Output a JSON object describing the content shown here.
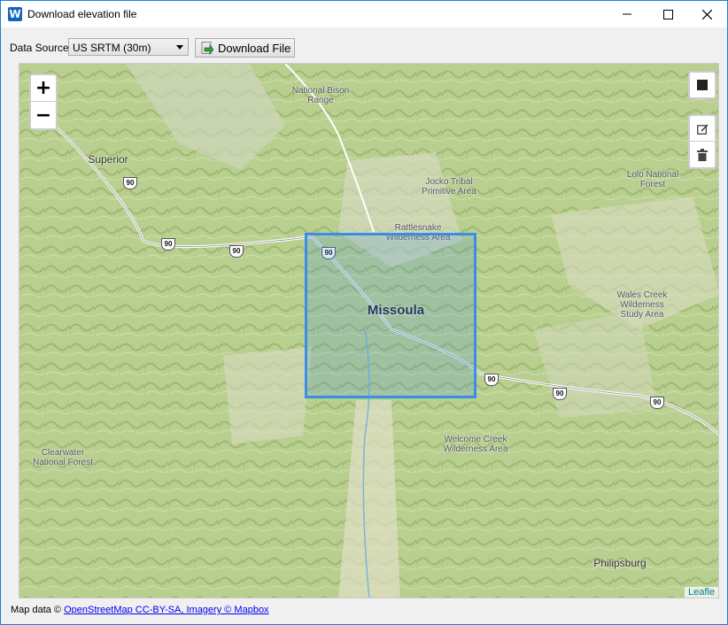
{
  "window": {
    "title": "Download elevation file",
    "app_icon_letter": "W",
    "minimize_icon": "minimize-icon",
    "maximize_icon": "maximize-icon",
    "close_icon": "close-icon"
  },
  "toolbar": {
    "data_source_label": "Data Source",
    "data_source_value": "US SRTM (30m)",
    "download_label": "Download File"
  },
  "map": {
    "zoom_in": "+",
    "zoom_out": "−",
    "draw_icon": "square-draw-icon",
    "edit_icon": "edit-icon",
    "delete_icon": "trash-icon",
    "labels": {
      "national_bison": "National Bison Range",
      "superior": "Superior",
      "jocko": "Jocko Tribal Primitive Area",
      "lolo": "Lolo National Forest",
      "rattlesnake": "Rattlesnake Wilderness Area",
      "missoula": "Missoula",
      "wales_creek": "Wales Creek Wilderness Study Area",
      "clearwater": "Clearwater National Forest",
      "welcome_creek": "Welcome Creek Wilderness Area",
      "philipsburg": "Philipsburg"
    },
    "highway": "90",
    "leaflet_attrib": "Leafle"
  },
  "footer": {
    "prefix": "Map data ©",
    "link": "OpenStreetMap CC-BY-SA, Imagery © Mapbox"
  },
  "colors": {
    "selection": "#3b8ee6",
    "titlebar_border": "#1883d7",
    "terrain": "#c9d9a4"
  }
}
